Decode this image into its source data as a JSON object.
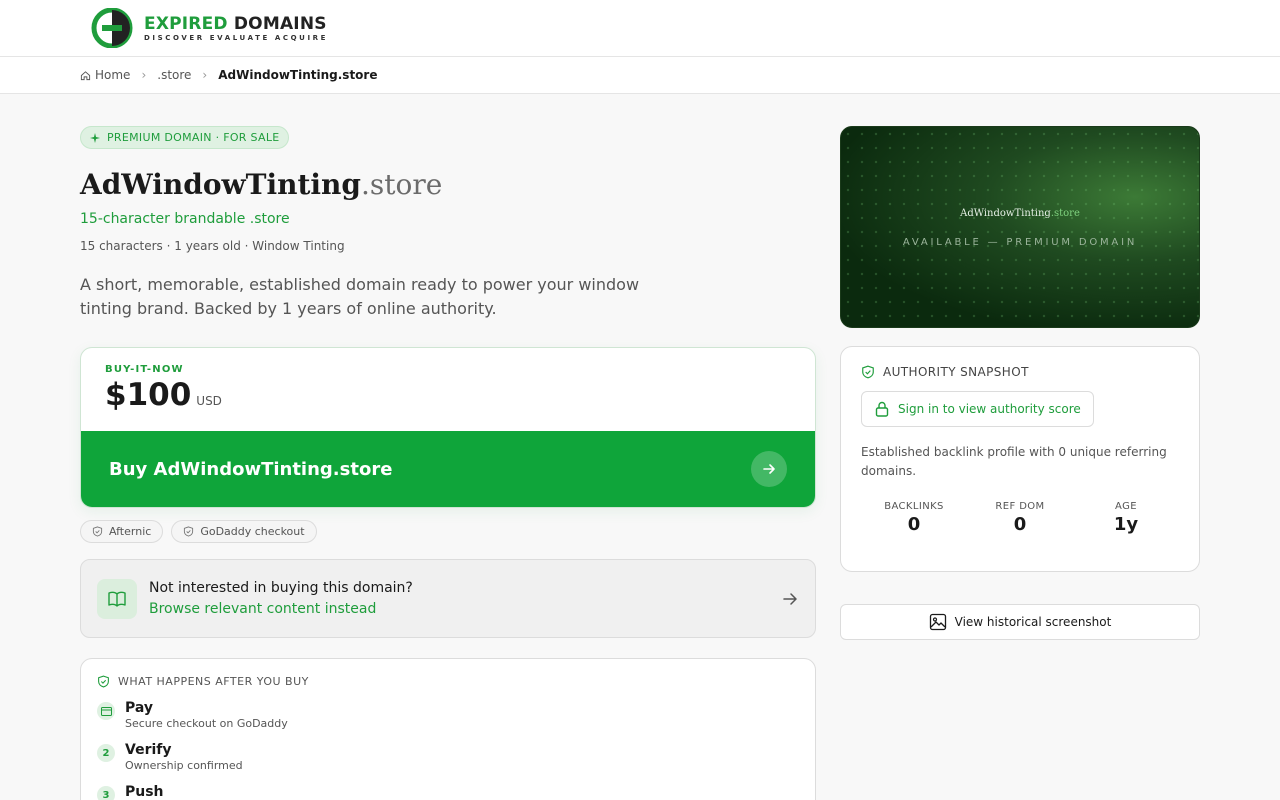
{
  "logo": {
    "word1": "EXPIRED",
    "word2": "DOMAINS",
    "tagline": "DISCOVER EVALUATE ACQUIRE"
  },
  "breadcrumb": {
    "home": "Home",
    "tld": ".store",
    "current": "AdWindowTinting.store"
  },
  "badge": "PREMIUM DOMAIN · FOR SALE",
  "domain": {
    "name": "AdWindowTinting",
    "tld": ".store"
  },
  "subtitle": "15-character brandable .store",
  "meta": "15 characters · 1 years old · Window Tinting",
  "description": "A short, memorable, established domain ready to power your window tinting brand. Backed by 1 years of online authority.",
  "buy": {
    "label": "BUY-IT-NOW",
    "price": "$100",
    "currency": "USD",
    "button": "Buy AdWindowTinting.store"
  },
  "chips": [
    "Afternic",
    "GoDaddy checkout"
  ],
  "browse": {
    "question": "Not interested in buying this domain?",
    "link": "Browse relevant content instead"
  },
  "after": {
    "heading": "WHAT HAPPENS AFTER YOU BUY",
    "steps": [
      {
        "num": "",
        "title": "Pay",
        "sub": "Secure checkout on GoDaddy"
      },
      {
        "num": "2",
        "title": "Verify",
        "sub": "Ownership confirmed"
      },
      {
        "num": "3",
        "title": "Push",
        "sub": ""
      }
    ]
  },
  "hero": {
    "name": "AdWindowTinting",
    "tld": ".store",
    "tagline": "AVAILABLE — PREMIUM DOMAIN"
  },
  "authority": {
    "heading": "AUTHORITY SNAPSHOT",
    "signin": "Sign in to view authority score",
    "description": "Established backlink profile with 0 unique referring domains.",
    "stats": [
      {
        "label": "BACKLINKS",
        "value": "0"
      },
      {
        "label": "REF DOM",
        "value": "0"
      },
      {
        "label": "AGE",
        "value": "1y"
      }
    ]
  },
  "history_button": "View historical screenshot",
  "colors": {
    "accent": "#1f9d3c",
    "button": "#0fa53a"
  }
}
